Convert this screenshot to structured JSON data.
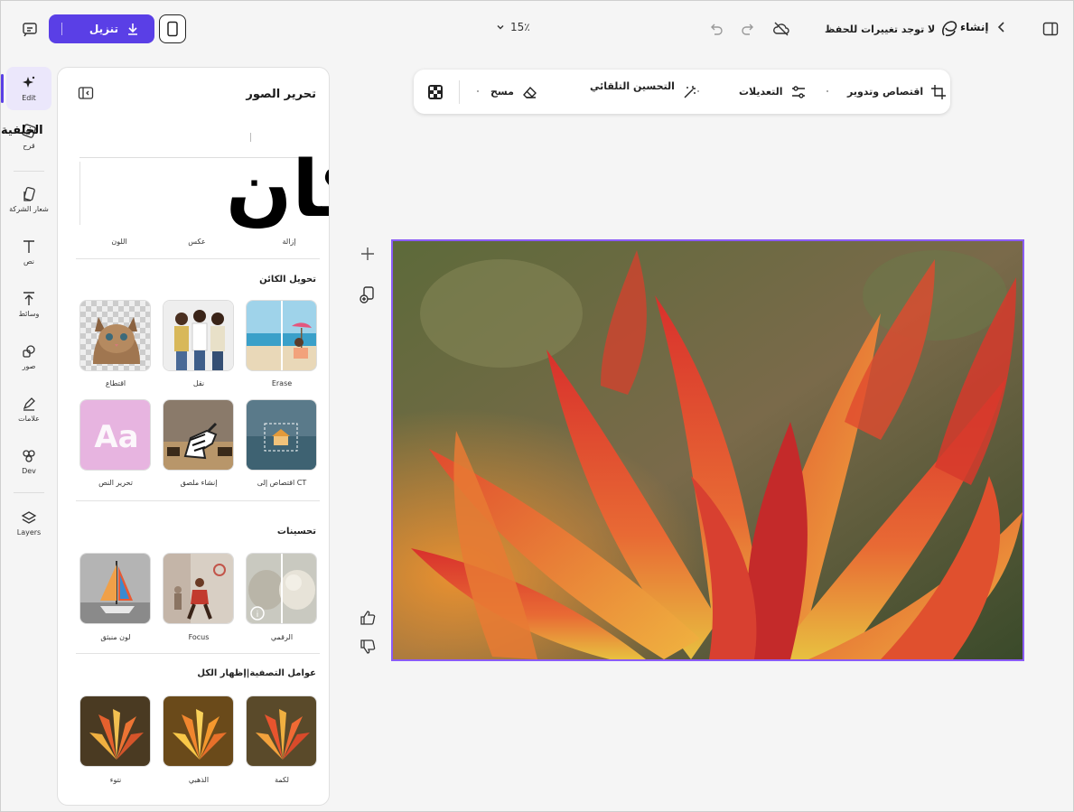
{
  "topbar": {
    "download_label": "تنزيل",
    "zoom_label": "15٪",
    "save_status": "لا توجد تغييرات للحفظ",
    "create_label": "إنشاء"
  },
  "rail": {
    "items": [
      {
        "label": "Edit"
      },
      {
        "label": "قرح"
      },
      {
        "label": "شعار الشركة"
      },
      {
        "label": "نص"
      },
      {
        "label": "وسائط"
      },
      {
        "label": "صور"
      },
      {
        "label": "علامات"
      },
      {
        "label": "Dev"
      },
      {
        "label": "Layers"
      }
    ],
    "overlap_label": "الخلفية"
  },
  "panel": {
    "title": "تحرير الصور",
    "big_glyph": "كان",
    "quick_labels": [
      "إزالة",
      "عكس",
      "اللون"
    ],
    "sections": {
      "transform": {
        "title": "تحويل الكائن",
        "tiles": [
          {
            "label": "Erase"
          },
          {
            "label": "نقل"
          },
          {
            "label": "اقتطاع"
          },
          {
            "label": "اقتصاص إلى CT"
          },
          {
            "label": "إنشاء ملصق"
          },
          {
            "label": "تحرير النص"
          }
        ]
      },
      "enhance": {
        "title": "تحسينات",
        "tiles": [
          {
            "label": "الرقمي"
          },
          {
            "label": "Focus"
          },
          {
            "label": "لون منبثق"
          }
        ]
      },
      "filters": {
        "title": "عوامل التصفية|إظهار الكل",
        "tiles": [
          {
            "label": "لكمة"
          },
          {
            "label": "الذهبي"
          },
          {
            "label": "نتوء"
          }
        ]
      }
    }
  },
  "toolbar": {
    "crop_label": "اقتصاص وتدوير",
    "adjust_label": "التعديلات",
    "auto_enhance_label": "التحسين التلقائي",
    "erase_label": "مسح"
  },
  "colors": {
    "accent": "#5a3fe6",
    "selection": "#8b5cf6"
  }
}
